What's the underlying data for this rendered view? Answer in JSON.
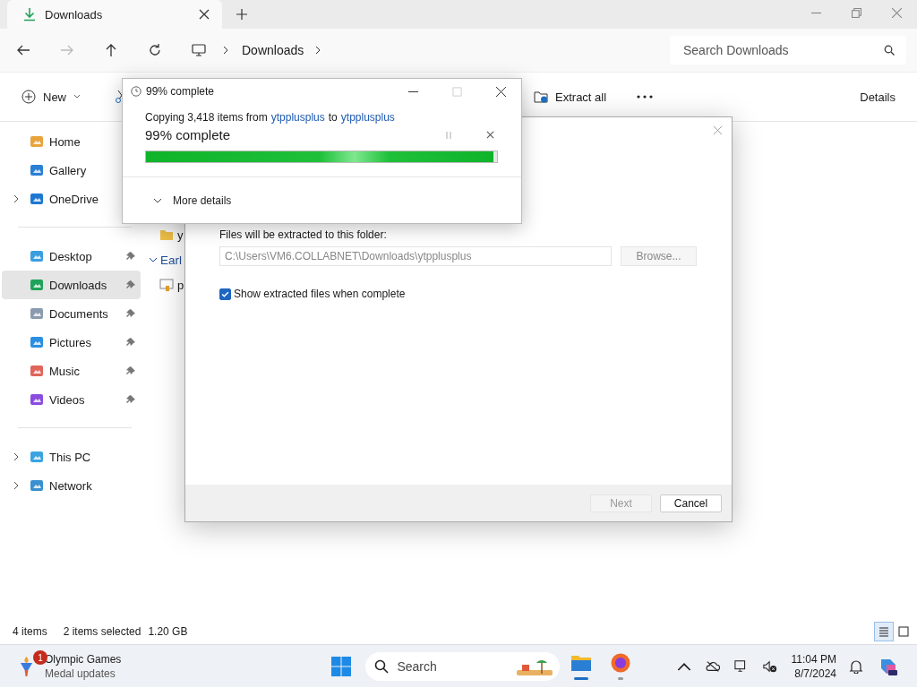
{
  "tab": {
    "title": "Downloads"
  },
  "address": {
    "crumb": "Downloads",
    "forward_disabled": true
  },
  "search": {
    "placeholder": "Search Downloads"
  },
  "commands": {
    "new": "New",
    "extract_all": "Extract all",
    "details": "Details"
  },
  "sidebar": {
    "groups": [
      {
        "items": [
          {
            "label": "Home",
            "expandable": false,
            "selected": false
          },
          {
            "label": "Gallery",
            "expandable": false,
            "selected": false
          },
          {
            "label": "OneDrive",
            "expandable": true,
            "selected": false
          }
        ]
      },
      {
        "items": [
          {
            "label": "Desktop",
            "pinned": true,
            "expandable": false,
            "selected": false
          },
          {
            "label": "Downloads",
            "pinned": true,
            "expandable": false,
            "selected": true
          },
          {
            "label": "Documents",
            "pinned": true,
            "expandable": false,
            "selected": false
          },
          {
            "label": "Pictures",
            "pinned": true,
            "expandable": false,
            "selected": false
          },
          {
            "label": "Music",
            "pinned": true,
            "expandable": false,
            "selected": false
          },
          {
            "label": "Videos",
            "pinned": true,
            "expandable": false,
            "selected": false
          }
        ]
      },
      {
        "items": [
          {
            "label": "This PC",
            "pinned": false,
            "expandable": true,
            "selected": false
          },
          {
            "label": "Network",
            "pinned": false,
            "expandable": true,
            "selected": false
          }
        ]
      }
    ]
  },
  "content": {
    "rows": [
      {
        "kind": "folder",
        "text": "y"
      },
      {
        "kind": "group",
        "text": "Earl"
      },
      {
        "kind": "file",
        "text": "p"
      }
    ]
  },
  "extract_dialog": {
    "label": "Files will be extracted to this folder:",
    "path": "C:\\Users\\VM6.COLLABNET\\Downloads\\ytpplusplus",
    "browse": "Browse...",
    "show_files": {
      "label": "Show extracted files when complete",
      "checked": true
    },
    "next": {
      "label": "Next",
      "disabled": true
    },
    "cancel": "Cancel"
  },
  "copy_dialog": {
    "title": "99% complete",
    "prefix": "Copying 3,418 items from",
    "source": "ytpplusplus",
    "middle": "to",
    "dest": "ytpplusplus",
    "status": "99% complete",
    "level": 0.99,
    "more": "More details"
  },
  "status_bar": {
    "count": "4 items",
    "selected": "2 items selected",
    "size": "1.20 GB",
    "views": [
      {
        "kind": "details",
        "selected": true
      },
      {
        "kind": "tiles",
        "selected": false
      }
    ]
  },
  "taskbar": {
    "widget": {
      "badge": "1",
      "title": "Olympic Games",
      "subtitle": "Medal updates"
    },
    "search": {
      "placeholder": "Search"
    },
    "apps": [
      {
        "kind": "explorer",
        "active": true
      },
      {
        "kind": "firefox",
        "active": false
      }
    ],
    "clock": {
      "time": "11:04 PM",
      "date": "8/7/2024"
    }
  }
}
